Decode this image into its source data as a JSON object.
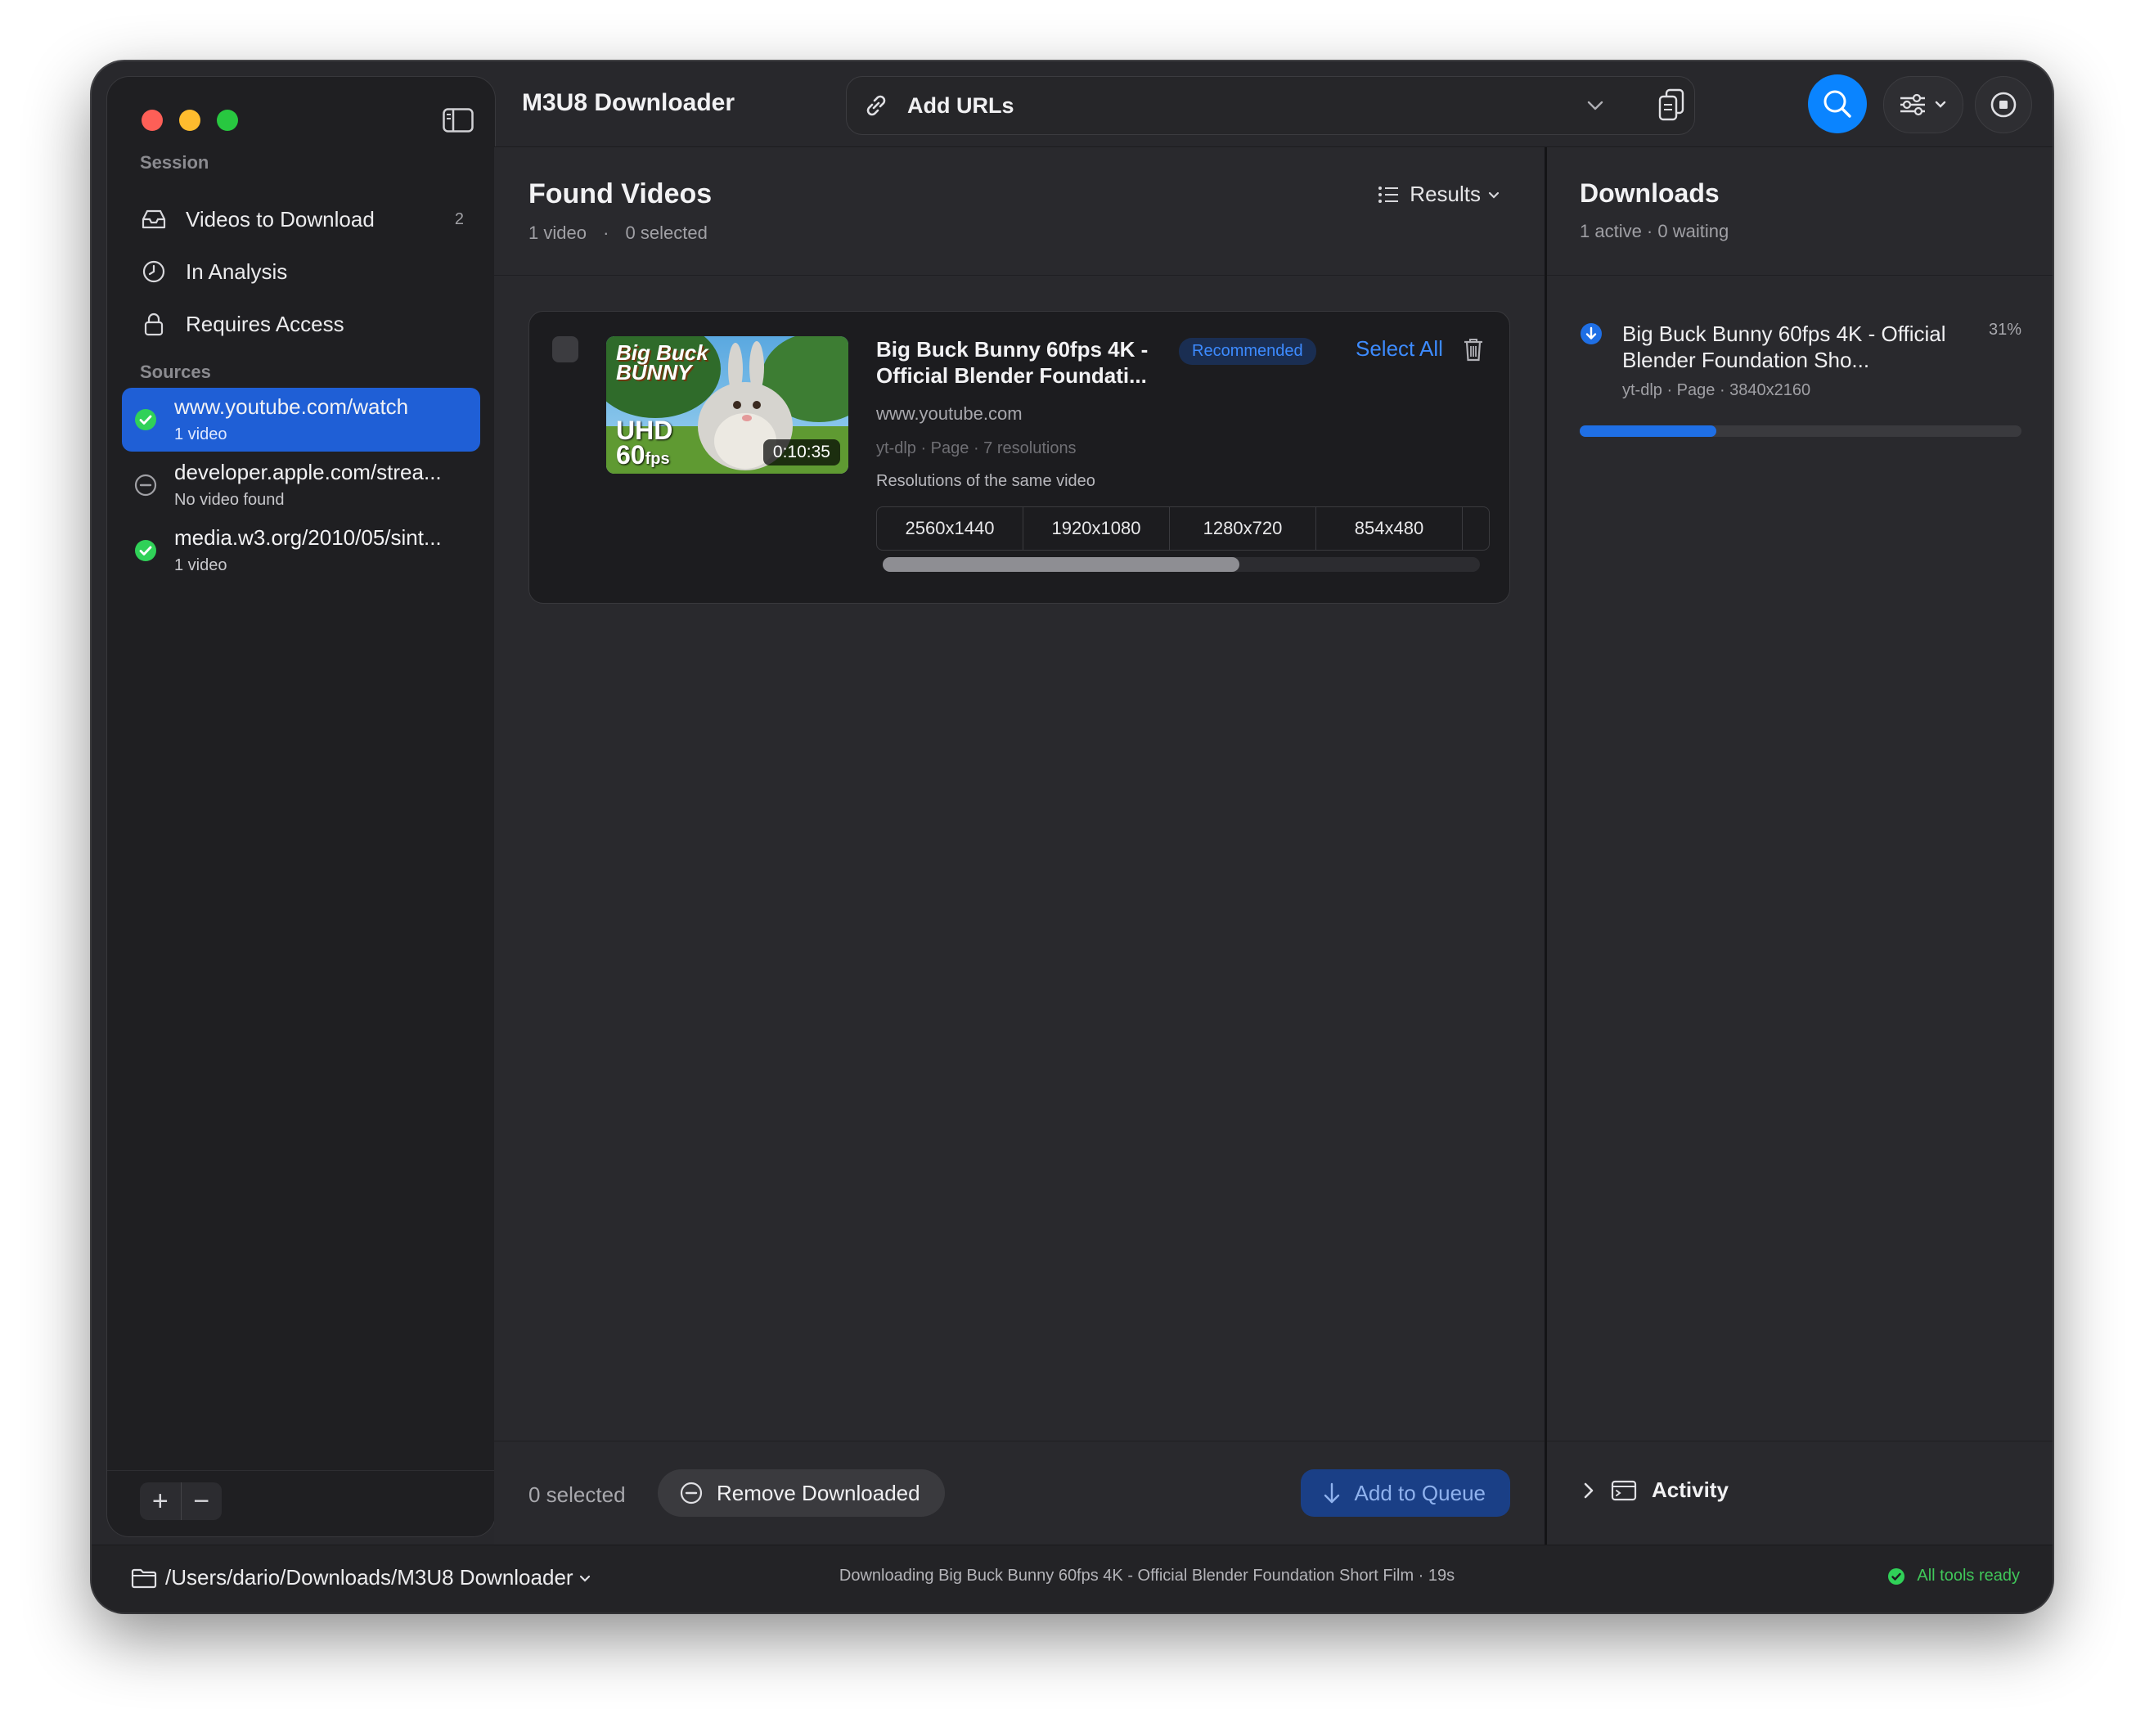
{
  "app": {
    "title": "M3U8 Downloader"
  },
  "toolbar": {
    "url_placeholder": "Add URLs"
  },
  "sidebar": {
    "session_label": "Session",
    "session_items": [
      {
        "label": "Videos to Download",
        "count": "2",
        "icon": "tray-icon"
      },
      {
        "label": "In Analysis",
        "count": "",
        "icon": "clock-icon"
      },
      {
        "label": "Requires Access",
        "count": "",
        "icon": "lock-icon"
      }
    ],
    "sources_label": "Sources",
    "sources": [
      {
        "url": "www.youtube.com/watch",
        "status": "1 video",
        "icon": "checkmark-circle-icon",
        "active": true
      },
      {
        "url": "developer.apple.com/strea...",
        "status": "No video found",
        "icon": "minus-circle-icon",
        "active": false
      },
      {
        "url": "media.w3.org/2010/05/sint...",
        "status": "1 video",
        "icon": "checkmark-circle-icon",
        "active": false
      }
    ]
  },
  "found": {
    "title": "Found Videos",
    "count": "1 video",
    "separator": "·",
    "selected": "0 selected",
    "results_label": "Results",
    "video": {
      "title": "Big Buck Bunny 60fps 4K - Official Blender Foundati...",
      "badge": "Recommended",
      "select_all": "Select All",
      "host": "www.youtube.com",
      "meta": "yt-dlp · Page · 7 resolutions",
      "resolutions_label": "Resolutions of the same video",
      "duration": "0:10:35",
      "thumb_text_1": "Big Buck",
      "thumb_text_2": "BUNNY",
      "thumb_text_3": "UHD",
      "thumb_text_4": "60",
      "thumb_text_5": "fps",
      "resolutions": [
        "2560x1440",
        "1920x1080",
        "1280x720",
        "854x480"
      ]
    },
    "footer": {
      "selected": "0 selected",
      "remove_label": "Remove Downloaded",
      "queue_label": "Add to Queue"
    }
  },
  "downloads": {
    "title": "Downloads",
    "summary": "1 active · 0 waiting",
    "item": {
      "title": "Big Buck Bunny 60fps 4K - Official Blender Foundation Sho...",
      "meta": "yt-dlp · Page · 3840x2160",
      "percent_label": "31%",
      "progress": 0.31
    },
    "activity_label": "Activity"
  },
  "status": {
    "path": "/Users/dario/Downloads/M3U8 Downloader",
    "message": "Downloading Big Buck Bunny 60fps 4K - Official Blender Foundation Short Film · 19s",
    "ready": "All tools ready"
  },
  "colors": {
    "accent": "#0a84ff",
    "selection": "#1f5fd6",
    "success": "#30d158",
    "close": "#fe5f57",
    "minimize": "#febc2e",
    "zoom": "#28c840"
  }
}
